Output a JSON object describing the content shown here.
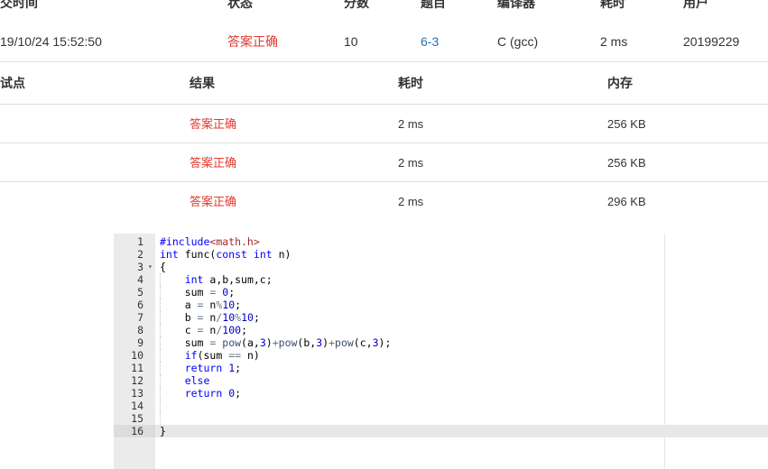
{
  "summary": {
    "headers": {
      "submit_time": "交时间",
      "status": "状态",
      "score": "分数",
      "problem": "题目",
      "compiler": "编译器",
      "time": "耗时",
      "user": "用户"
    },
    "row": {
      "submit_time": "19/10/24 15:52:50",
      "status": "答案正确",
      "score": "10",
      "problem": "6-3",
      "compiler": "C (gcc)",
      "time": "2 ms",
      "user": "20199229"
    }
  },
  "cases": {
    "headers": {
      "case": "试点",
      "result": "结果",
      "time": "耗时",
      "memory": "内存"
    },
    "rows": [
      {
        "result": "答案正确",
        "time": "2 ms",
        "memory": "256 KB"
      },
      {
        "result": "答案正确",
        "time": "2 ms",
        "memory": "256 KB"
      },
      {
        "result": "答案正确",
        "time": "2 ms",
        "memory": "296 KB"
      }
    ]
  },
  "code": {
    "language": "c",
    "active_line": 16,
    "lines": [
      "#include<math.h>",
      "int func(const int n)",
      "{",
      "    int a,b,sum,c;",
      "    sum = 0;",
      "    a = n%10;",
      "    b = n/10%10;",
      "    c = n/100;",
      "    sum = pow(a,3)+pow(b,3)+pow(c,3);",
      "    if(sum == n)",
      "    return 1;",
      "    else",
      "    return 0;",
      "",
      "",
      "}"
    ],
    "line_numbers": [
      "1",
      "2",
      "3",
      "4",
      "5",
      "6",
      "7",
      "8",
      "9",
      "10",
      "11",
      "12",
      "13",
      "14",
      "15",
      "16"
    ],
    "fold_marker": "▾"
  },
  "colors": {
    "accepted": "#e03a2f",
    "link": "#2a6fb5",
    "keyword": "#0000ff"
  }
}
